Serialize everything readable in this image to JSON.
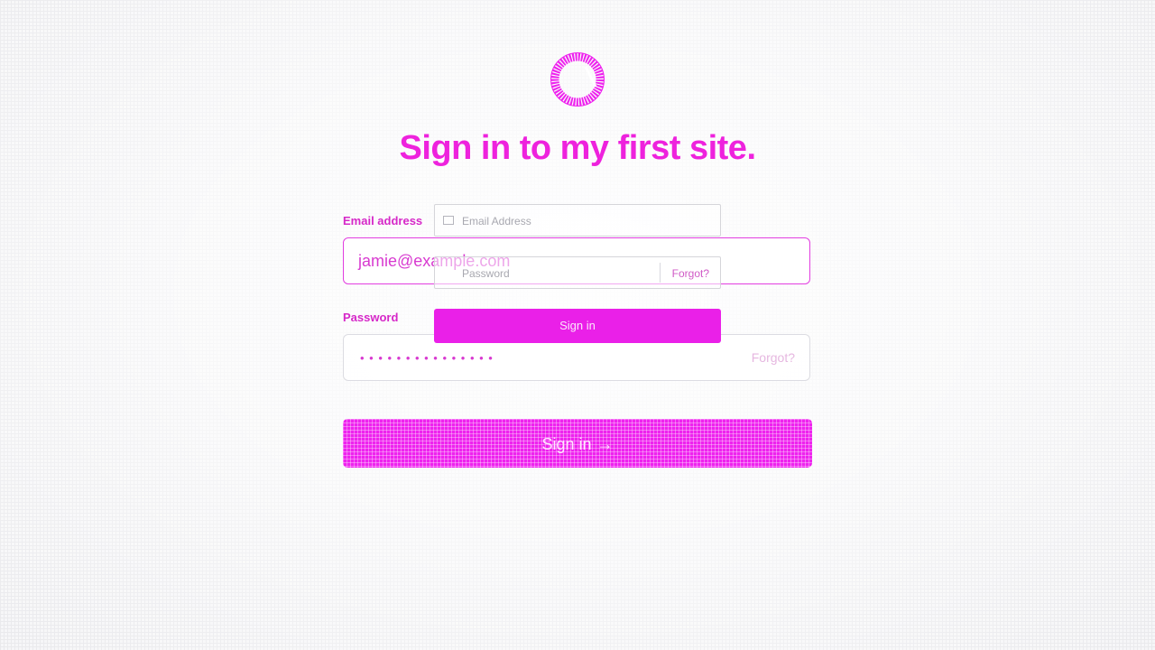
{
  "page": {
    "title": "Sign in to my first site.",
    "accent_color": "#ee22dd",
    "logo_icon": "ring-logo-icon"
  },
  "form": {
    "email_label": "Email address",
    "email_value": "jamie@example.com",
    "password_label": "Password",
    "password_mask": "• • • • • • • • • • • • • • •",
    "forgot_label": "Forgot?",
    "submit_label": "Sign in",
    "submit_icon": "arrow-right-icon"
  },
  "ghost_form": {
    "email_placeholder": "Email Address",
    "password_placeholder": "Password",
    "forgot_label": "Forgot?",
    "submit_label": "Sign in"
  }
}
